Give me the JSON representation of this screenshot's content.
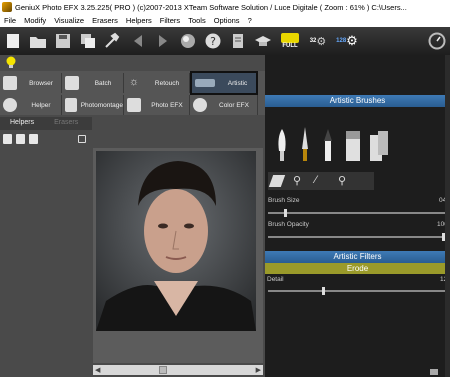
{
  "window": {
    "title": "GeniuX Photo EFX 3.25.225( PRO ) (c)2007-2013 XTeam Software Solution / Luce Digitale ( Zoom : 61% ) C:\\Users..."
  },
  "menu": [
    "File",
    "Modify",
    "Visualize",
    "Erasers",
    "Helpers",
    "Filters",
    "Tools",
    "Options",
    "?"
  ],
  "toolbar": {
    "full_label": "FULL",
    "bit32_label": "32",
    "bit128_label": "128"
  },
  "modes": {
    "browser": "Browser",
    "batch": "Batch",
    "retouch": "Retouch",
    "artistic": "Artistic",
    "helper": "Helper",
    "photomontage": "Photomontage",
    "photo_efx": "Photo EFX",
    "color_efx": "Color EFX"
  },
  "helpers_panel": {
    "tabs": [
      "Helpers",
      "Erasers"
    ]
  },
  "artistic_brushes": {
    "title": "Artistic Brushes",
    "brush_size_label": "Brush Size",
    "brush_size_value": "04",
    "brush_opacity_label": "Brush Opacity",
    "brush_opacity_value": "100"
  },
  "artistic_filters": {
    "title": "Artistic Filters",
    "selected_filter": "Erode",
    "detail_label": "Detail",
    "detail_value": "12"
  }
}
